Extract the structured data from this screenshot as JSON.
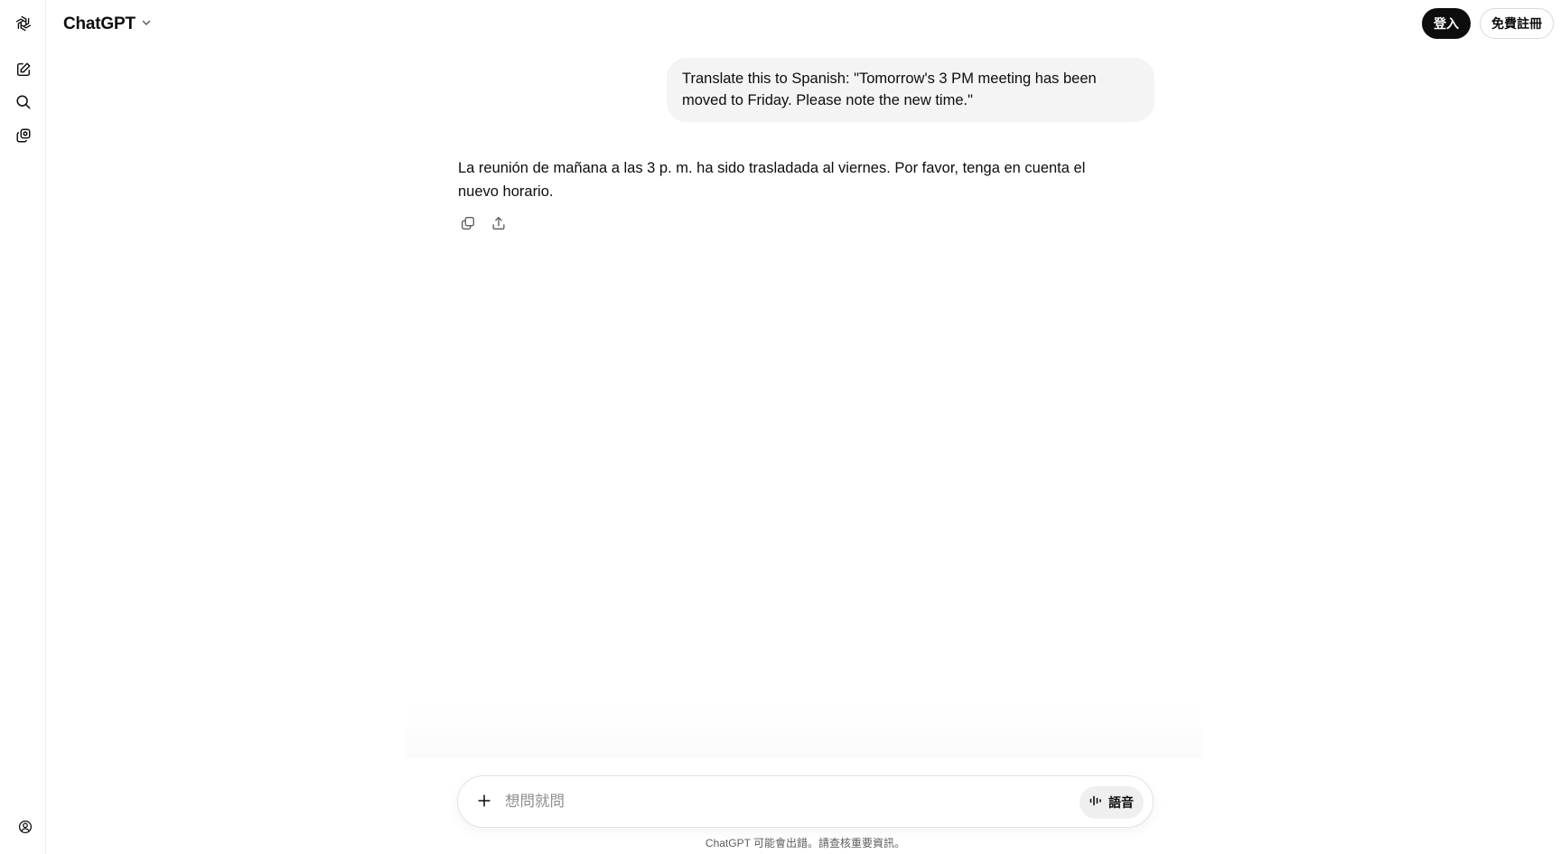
{
  "header": {
    "model_name": "ChatGPT",
    "login_label": "登入",
    "signup_label": "免費註冊"
  },
  "sidebar": {
    "icons": [
      "openai-logo-icon",
      "new-chat-icon",
      "search-icon",
      "library-icon",
      "profile-icon"
    ]
  },
  "conversation": {
    "user_message": "Translate this to Spanish: \"Tomorrow's 3 PM meeting has been moved to Friday. Please note the new time.\"",
    "assistant_message": "La reunión de mañana a las 3 p. m. ha sido trasladada al viernes. Por favor, tenga en cuenta el nuevo horario.",
    "actions": [
      "copy-icon",
      "share-icon"
    ]
  },
  "composer": {
    "placeholder": "想問就問",
    "value": "",
    "voice_label": "語音"
  },
  "footer": {
    "disclaimer": "ChatGPT 可能會出錯。請查核重要資訊。"
  }
}
